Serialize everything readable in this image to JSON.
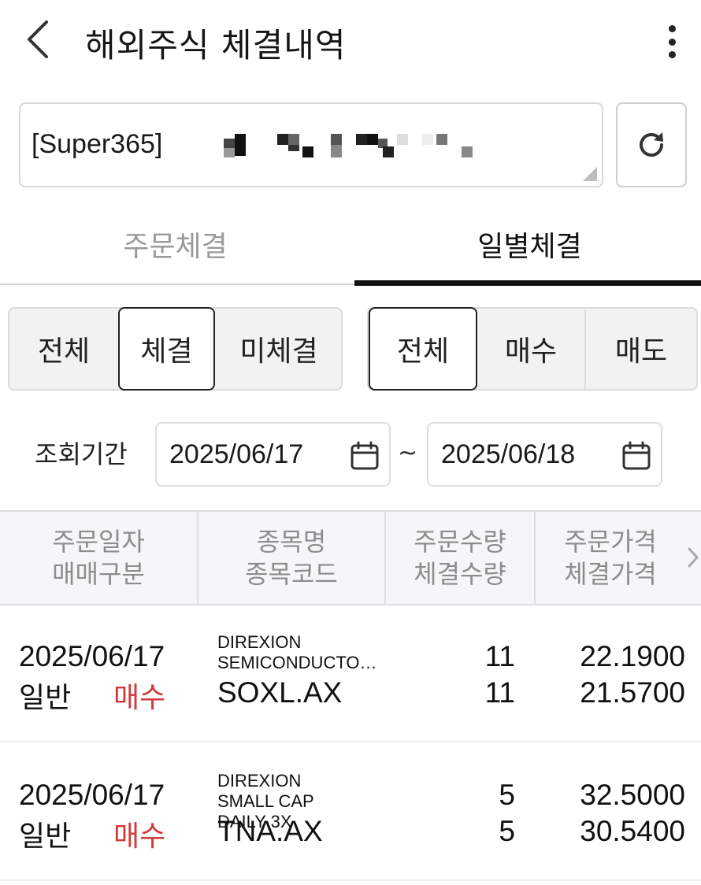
{
  "header": {
    "title": "해외주식 체결내역",
    "back_icon": "chevron-left-icon",
    "more_icon": "more-vertical-icon"
  },
  "account": {
    "label": "[Super365]",
    "refresh_icon": "refresh-icon"
  },
  "tabs": [
    {
      "label": "주문체결",
      "active": false
    },
    {
      "label": "일별체결",
      "active": true
    }
  ],
  "filters": {
    "status": [
      "전체",
      "체결",
      "미체결"
    ],
    "status_selected": "체결",
    "side": [
      "전체",
      "매수",
      "매도"
    ],
    "side_selected": "전체"
  },
  "period": {
    "label": "조회기간",
    "from": "2025/06/17",
    "separator": "~",
    "to": "2025/06/18",
    "calendar_icon": "calendar-icon"
  },
  "table": {
    "columns": [
      {
        "line1": "주문일자",
        "line2": "매매구분"
      },
      {
        "line1": "종목명",
        "line2": "종목코드"
      },
      {
        "line1": "주문수량",
        "line2": "체결수량"
      },
      {
        "line1": "주문가격",
        "line2": "체결가격"
      }
    ],
    "rows": [
      {
        "date": "2025/06/17",
        "order_type": "일반",
        "side": "매수",
        "name": "DIREXION SEMICONDUCTO…",
        "code": "SOXL.AX",
        "order_qty": "11",
        "exec_qty": "11",
        "order_price": "22.1900",
        "exec_price": "21.5700"
      },
      {
        "date": "2025/06/17",
        "order_type": "일반",
        "side": "매수",
        "name": "DIREXION SMALL CAP DAILY 3X",
        "code": "TNA.AX",
        "order_qty": "5",
        "exec_qty": "5",
        "order_price": "32.5000",
        "exec_price": "30.5400"
      }
    ]
  },
  "colors": {
    "buy": "#d13a3a",
    "active": "#111111",
    "inactive": "#9a9a9a"
  }
}
